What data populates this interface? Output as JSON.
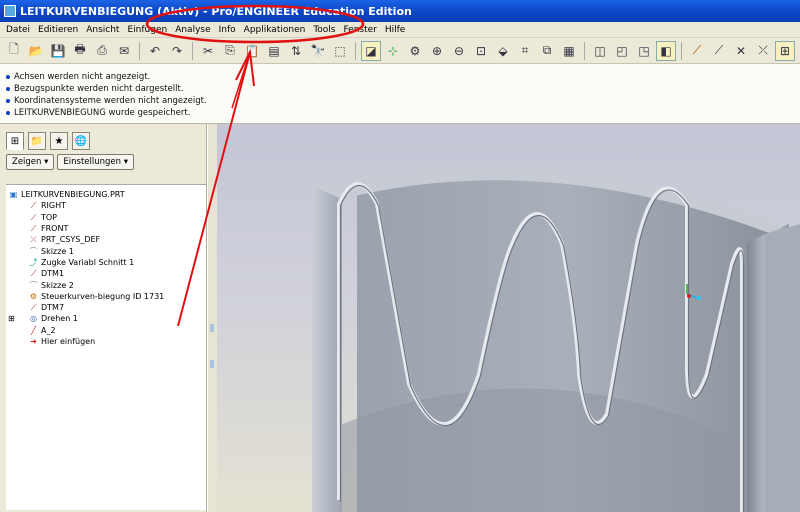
{
  "window": {
    "title": "LEITKURVENBIEGUNG (Aktiv) - Pro/ENGINEER Education Edition"
  },
  "menu": [
    "Datei",
    "Editieren",
    "Ansicht",
    "Einfügen",
    "Analyse",
    "Info",
    "Applikationen",
    "Tools",
    "Fenster",
    "Hilfe"
  ],
  "toolbar": {
    "icons": [
      "new-icon",
      "open-icon",
      "save-icon",
      "print-icon",
      "print-preview-icon",
      "send-icon",
      "undo-icon",
      "redo-icon",
      "cut-icon",
      "copy-icon",
      "paste-icon",
      "paste-special-icon",
      "regenerate-icon",
      "find-icon",
      "select-box-icon",
      "repaint-icon",
      "spin-center-icon",
      "orient-icon",
      "zoom-in-icon",
      "zoom-out-icon",
      "refit-icon",
      "reorient-icon",
      "saved-views-icon",
      "layers-icon",
      "appearance-icon",
      "wireframe-icon",
      "hidden-line-icon",
      "no-hidden-icon",
      "shaded-icon",
      "datum-planes-icon",
      "datum-axes-icon",
      "datum-points-icon",
      "coord-sys-icon",
      "annotation-icon"
    ]
  },
  "messages": [
    "Achsen werden nicht angezeigt.",
    "Bezugspunkte werden nicht dargestellt.",
    "Koordinatensysteme werden nicht angezeigt.",
    "LEITKURVENBIEGUNG wurde gespeichert."
  ],
  "panel": {
    "show_label": "Zeigen ▾",
    "settings_label": "Einstellungen ▾"
  },
  "tree": [
    {
      "label": "LEITKURVENBIEGUNG.PRT",
      "icon": "part-icon",
      "level": 0
    },
    {
      "label": "RIGHT",
      "icon": "datum-plane-icon",
      "level": 1
    },
    {
      "label": "TOP",
      "icon": "datum-plane-icon",
      "level": 1
    },
    {
      "label": "FRONT",
      "icon": "datum-plane-icon",
      "level": 1
    },
    {
      "label": "PRT_CSYS_DEF",
      "icon": "coordinate-system-icon",
      "level": 1
    },
    {
      "label": "Skizze 1",
      "icon": "sketch-icon",
      "level": 1
    },
    {
      "label": "Zugke Variabl Schnitt 1",
      "icon": "sweep-icon",
      "level": 1
    },
    {
      "label": "DTM1",
      "icon": "datum-plane-icon",
      "level": 1
    },
    {
      "label": "Skizze 2",
      "icon": "sketch-icon",
      "level": 1
    },
    {
      "label": "Steuerkurven-biegung ID 1731",
      "icon": "feature-icon",
      "level": 1
    },
    {
      "label": "DTM7",
      "icon": "datum-plane-icon",
      "level": 1
    },
    {
      "label": "Drehen 1",
      "icon": "revolve-icon",
      "level": 1,
      "expand": "+"
    },
    {
      "label": "A_2",
      "icon": "axis-icon",
      "level": 1
    },
    {
      "label": "Hier einfügen",
      "icon": "insert-here-icon",
      "level": 1
    }
  ],
  "colors": {
    "title_bar": "#0a43c2",
    "annotation": "#e01010",
    "model_surface": "#b5bcc6",
    "model_inner": "#8f97a3"
  }
}
